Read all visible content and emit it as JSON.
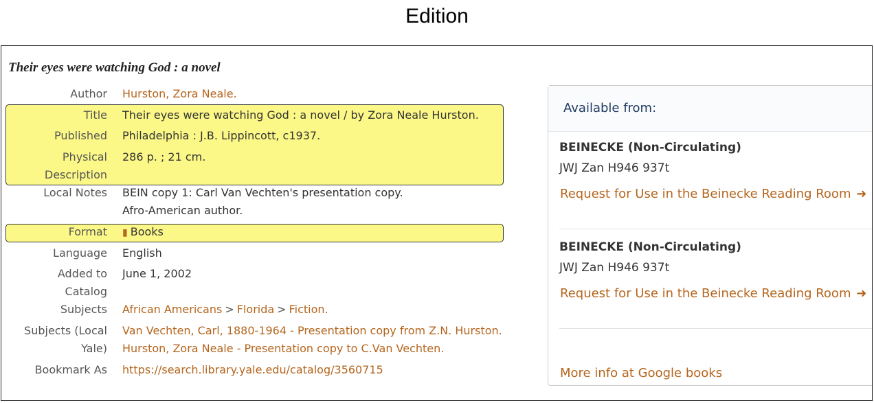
{
  "page": {
    "heading": "Edition"
  },
  "record": {
    "title": "Their eyes were watching God : a novel",
    "fields": {
      "author_label": "Author",
      "author_value": "Hurston, Zora Neale.",
      "title_label": "Title",
      "title_value": "Their eyes were watching God : a novel / by Zora Neale Hurston.",
      "published_label": "Published",
      "published_value": "Philadelphia : J.B. Lippincott, c1937.",
      "physical_label_1": "Physical",
      "physical_label_2": "Description",
      "physical_value": "286 p. ; 21 cm.",
      "local_notes_label": "Local Notes",
      "local_notes_1": "BEIN copy 1: Carl Van Vechten's presentation copy.",
      "local_notes_2": "Afro-American author.",
      "format_label": "Format",
      "format_value": "Books",
      "language_label": "Language",
      "language_value": "English",
      "added_label_1": "Added to",
      "added_label_2": "Catalog",
      "added_value": "June 1, 2002",
      "subjects_label": "Subjects",
      "subjects_items": [
        "African Americans",
        "Florida",
        "Fiction."
      ],
      "subjects_sep": ">",
      "subjects_local_label_1": "Subjects (Local",
      "subjects_local_label_2": "Yale)",
      "subjects_local_1": "Van Vechten, Carl, 1880-1964 - Presentation copy from Z.N. Hurston.",
      "subjects_local_2": "Hurston, Zora Neale - Presentation copy to C.Van Vechten.",
      "bookmark_label": "Bookmark As",
      "bookmark_value": "https://search.library.yale.edu/catalog/3560715"
    }
  },
  "availability": {
    "title": "Available from:",
    "locations": [
      {
        "name": "BEINECKE (Non-Circulating)",
        "call_number": "JWJ Zan H946 937t",
        "request": "Request for Use in the Beinecke Reading Room"
      },
      {
        "name": "BEINECKE (Non-Circulating)",
        "call_number": "JWJ Zan H946 937t",
        "request": "Request for Use in the Beinecke Reading Room"
      }
    ],
    "more_info": "More info at Google books"
  },
  "icons": {
    "format": "book-icon",
    "request": "arrow-right-icon"
  },
  "colors": {
    "link": "#b5651d",
    "highlight": "#fbf887",
    "panel_title": "#1f3b63"
  }
}
